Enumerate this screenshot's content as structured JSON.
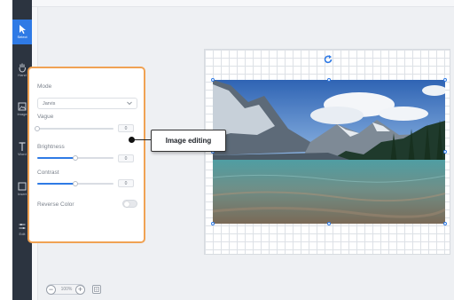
{
  "toolbar": {
    "items": [
      {
        "label": "Select",
        "icon": "cursor-arrow-icon",
        "active": true
      },
      {
        "label": "Hand",
        "icon": "hand-icon",
        "active": false
      },
      {
        "label": "Image",
        "icon": "image-icon",
        "active": false
      },
      {
        "label": "Word",
        "icon": "text-icon",
        "active": false
      },
      {
        "label": "Insert",
        "icon": "insert-icon",
        "active": false
      },
      {
        "label": "Edit",
        "icon": "sliders-icon",
        "active": false
      }
    ]
  },
  "panel": {
    "mode_label": "Mode",
    "mode_value": "Jarvis",
    "vague_label": "Vague",
    "vague_value": "0",
    "vague_level": 0.0,
    "brightness_label": "Brightness",
    "brightness_value": "0",
    "brightness_level": 0.5,
    "contrast_label": "Contrast",
    "contrast_value": "0",
    "contrast_level": 0.5,
    "reverse_label": "Reverse Color",
    "reverse_on": false
  },
  "callout": {
    "text": "Image editing"
  },
  "zoom": {
    "value": "100%",
    "minus_label": "−",
    "plus_label": "+"
  },
  "colors": {
    "accent": "#2f7ae5",
    "highlight": "#f0a253",
    "toolbar_bg": "#2c3440"
  }
}
